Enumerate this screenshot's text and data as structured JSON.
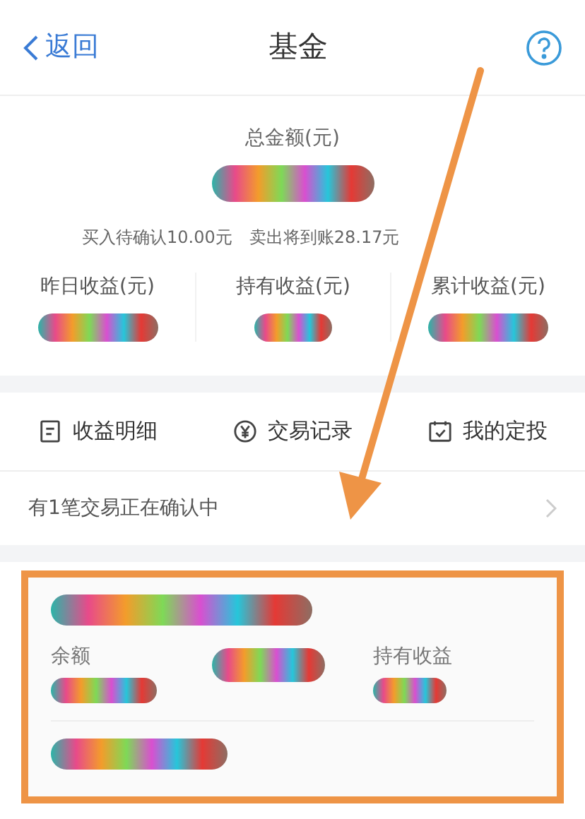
{
  "header": {
    "back_label": "返回",
    "title": "基金"
  },
  "summary": {
    "total_label": "总金额(元)",
    "pending_buy": "买入待确认10.00元",
    "pending_sell": "卖出将到账28.17元"
  },
  "stats": [
    {
      "label": "昨日收益(元)"
    },
    {
      "label": "持有收益(元)"
    },
    {
      "label": "累计收益(元)"
    }
  ],
  "actions": [
    {
      "kind": "document",
      "label": "收益明细"
    },
    {
      "kind": "yuan",
      "label": "交易记录"
    },
    {
      "kind": "calendar",
      "label": "我的定投"
    }
  ],
  "notice": {
    "text": "有1笔交易正在确认中"
  },
  "fund_card": {
    "columns": [
      {
        "label": "余额"
      },
      {
        "label": "持有收益"
      }
    ]
  }
}
